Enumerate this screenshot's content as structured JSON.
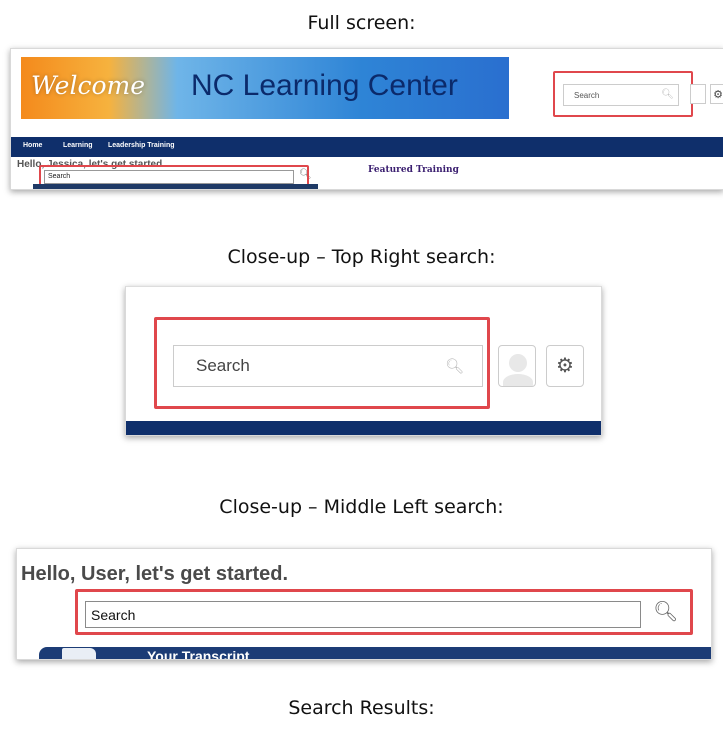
{
  "captions": {
    "full_screen": "Full screen:",
    "top_right": "Close-up – Top Right search:",
    "middle_left": "Close-up – Middle Left search:",
    "search_results": "Search Results:"
  },
  "full_screen": {
    "banner_welcome": "Welcome",
    "banner_title": "NC Learning Center",
    "search_placeholder": "Search",
    "nav": [
      "Home",
      "Learning",
      "Leadership Training"
    ],
    "greeting": "Hello, Jessica, let's get started.",
    "middle_search_value": "Search",
    "featured_heading": "Featured Training"
  },
  "closeup_top_right": {
    "search_placeholder": "Search"
  },
  "closeup_middle_left": {
    "greeting": "Hello, User, let's get started.",
    "search_value": "Search",
    "section_title": "Your Transcript"
  },
  "colors": {
    "highlight_box": "#e0474c",
    "nav_bar": "#0f2f6b",
    "banner_title": "#0b2a6b"
  }
}
